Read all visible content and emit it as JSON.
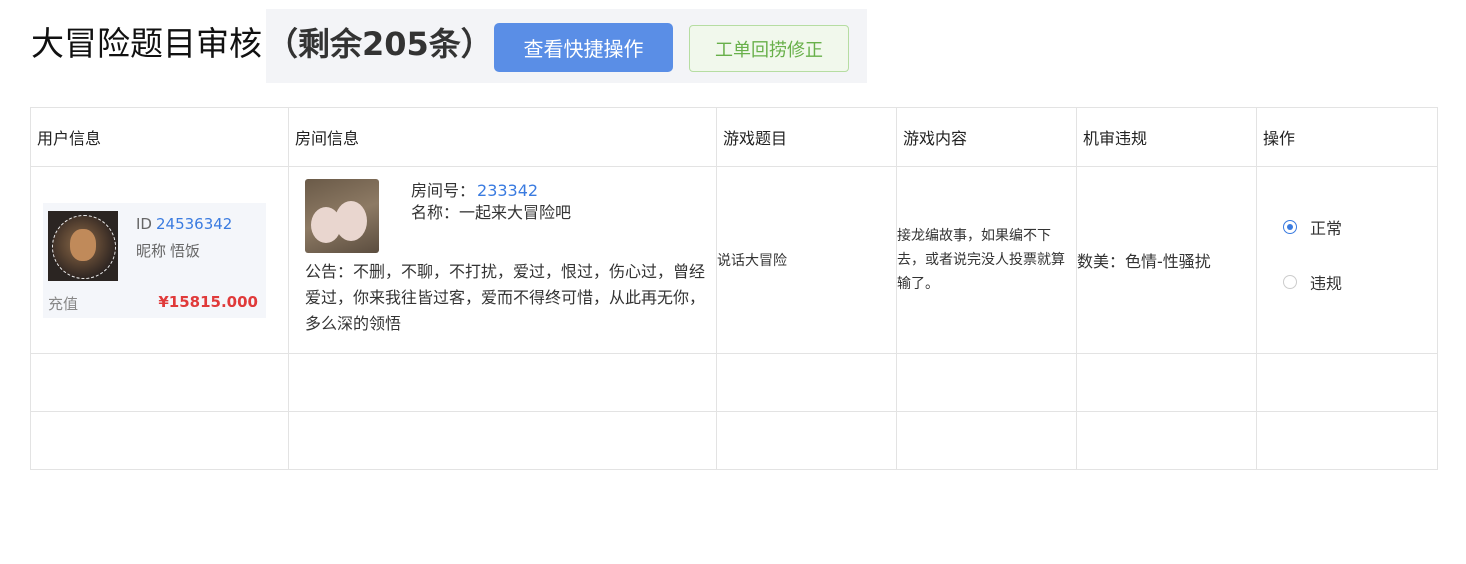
{
  "header": {
    "title": "大冒险题目审核",
    "remaining": "（剩余205条）",
    "quick_button": "查看快捷操作",
    "fix_button": "工单回捞修正"
  },
  "table": {
    "columns": [
      "用户信息",
      "房间信息",
      "游戏题目",
      "游戏内容",
      "机审违规",
      "操作"
    ],
    "row": {
      "user": {
        "id_label": "ID",
        "id_value": "24536342",
        "nick_label": "昵称",
        "nick_value": "悟饭",
        "charge_label": "充值",
        "charge_value": "¥15815.000"
      },
      "room": {
        "no_label": "房间号：",
        "no_value": "233342",
        "name": "名称：一起来大冒险吧",
        "notice": "公告：不删，不聊，不打扰，爱过，恨过，伤心过，曾经爱过，你来我往皆过客，爱而不得终可惜，从此再无你，多么深的领悟"
      },
      "question": "说话大冒险",
      "content": "接龙编故事，如果编不下去，或者说完没人投票就算输了。",
      "violation": "数美：色情-性骚扰",
      "ops": {
        "normal": "正常",
        "violate": "违规",
        "selected": "正常"
      }
    }
  },
  "colors": {
    "primary": "#5a8ee6",
    "success_text": "#68b04a",
    "link": "#3a7be0",
    "money": "#e03a3a"
  }
}
